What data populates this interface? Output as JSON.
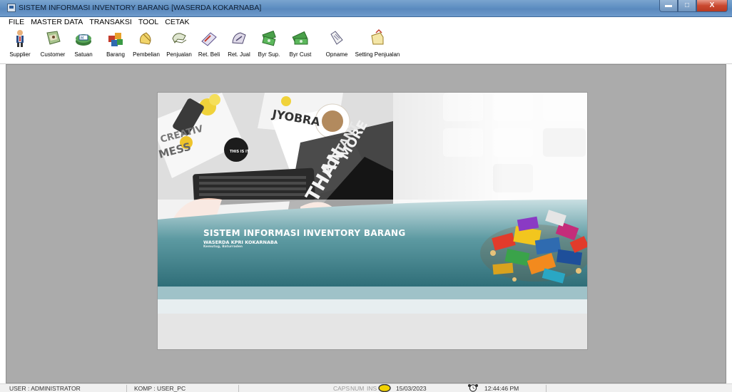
{
  "window": {
    "title": "SISTEM INFORMASI INVENTORY BARANG [WASERDA KOKARNABA]",
    "minimize_glyph": "▬",
    "maximize_glyph": "□",
    "close_glyph": "X"
  },
  "menu": [
    "FILE",
    "MASTER DATA",
    "TRANSAKSI",
    "TOOL",
    "CETAK"
  ],
  "toolbar": {
    "buttons": [
      {
        "label": "Supplier",
        "icon": "supplier-icon"
      },
      {
        "label": "Customer",
        "icon": "customer-icon"
      },
      {
        "label": "Satuan",
        "icon": "satuan-icon"
      },
      {
        "label": "Barang",
        "icon": "barang-icon"
      },
      {
        "label": "Pembelian",
        "icon": "pembelian-icon"
      },
      {
        "label": "Penjualan",
        "icon": "penjualan-icon"
      },
      {
        "label": "Ret. Beli",
        "icon": "return-beli-icon"
      },
      {
        "label": "Ret. Jual",
        "icon": "return-jual-icon"
      },
      {
        "label": "Byr Sup.",
        "icon": "bayar-supplier-icon"
      },
      {
        "label": "Byr Cust",
        "icon": "bayar-customer-icon"
      },
      {
        "label": "Opname",
        "icon": "opname-icon"
      },
      {
        "label": "Setting Penjualan",
        "icon": "setting-penjualan-icon"
      }
    ]
  },
  "splash": {
    "title": "SISTEM INFORMASI INVENTORY BARANG",
    "subtitle": "WASERDA KPRI KOKARNABA",
    "location": "Kemutug, Baturraden",
    "photo_text": {
      "jyobra": "JYOBRA",
      "creativ": "CREATIV",
      "mess": "MESS",
      "this_is_it": "THIS IS IT",
      "more": "MORE",
      "portant": "PORTANT",
      "than": "THAN"
    }
  },
  "status": {
    "user": "USER : ADMINISTRATOR",
    "komp": "KOMP : USER_PC",
    "caps": "CAPS",
    "num": "NUM",
    "ins": "INS",
    "date": "15/03/2023",
    "time": "12:44:46 PM"
  },
  "colors": {
    "title_bar": "#6e9acb",
    "workspace": "#ababab",
    "splash_band": "#3e7d87"
  }
}
